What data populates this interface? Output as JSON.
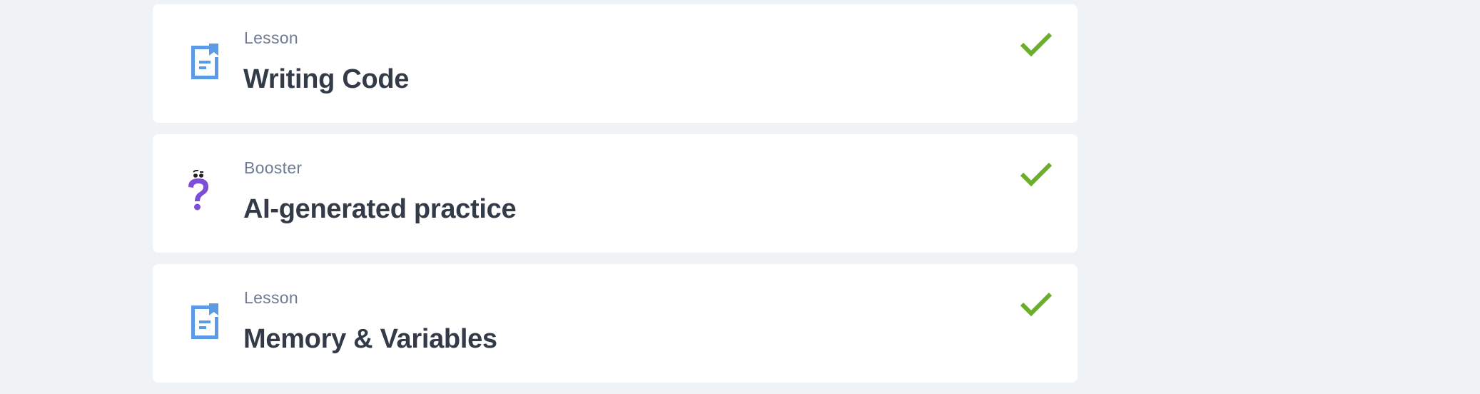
{
  "colors": {
    "page_background": "#eff3f6",
    "card_background": "#ffffff",
    "lesson_icon": "#5b9be6",
    "booster_icon": "#7d4fd6",
    "check": "#6aae2b",
    "kind_text": "#6e7b92",
    "title_text": "#333a48"
  },
  "items": [
    {
      "kind": "Lesson",
      "title": "Writing Code",
      "icon": "lesson-doc-icon",
      "completed": true
    },
    {
      "kind": "Booster",
      "title": "AI-generated practice",
      "icon": "question-mascot-icon",
      "completed": true
    },
    {
      "kind": "Lesson",
      "title": "Memory & Variables",
      "icon": "lesson-doc-icon",
      "completed": true
    }
  ]
}
